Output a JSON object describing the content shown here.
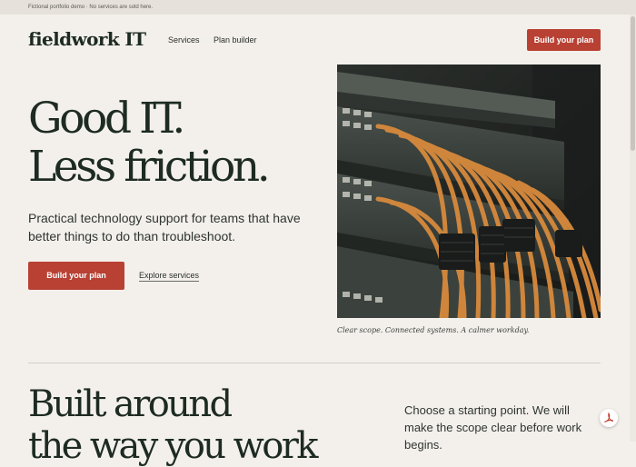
{
  "notice": {
    "text": "Fictional portfolio demo · No services are sold here."
  },
  "header": {
    "logo": "fieldwork IT",
    "nav": [
      {
        "label": "Services"
      },
      {
        "label": "Plan builder"
      }
    ],
    "cta_label": "Build your plan"
  },
  "hero": {
    "title_lines": [
      "Good IT.",
      "Less friction."
    ],
    "subtitle": "Practical technology support for teams that have better things to do than troubleshoot.",
    "primary_cta": "Build your plan",
    "secondary_cta": "Explore services",
    "image_caption": "Clear scope. Connected systems. A calmer workday."
  },
  "section": {
    "title_lines": [
      "Built around",
      "the way you work"
    ],
    "text": "Choose a starting point. We will make the scope clear before work begins."
  },
  "colors": {
    "accent": "#b84134",
    "background": "#f3f0eb",
    "ink": "#1d2b22"
  },
  "icons": {
    "floating_badge": "pdf-icon"
  }
}
